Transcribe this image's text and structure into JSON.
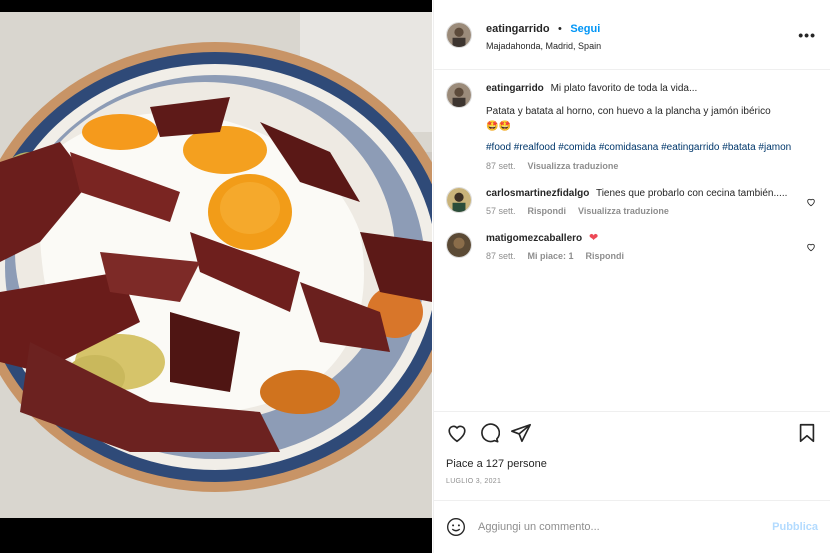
{
  "post": {
    "username": "eatingarrido",
    "follow_label": "Segui",
    "separator": "•",
    "location": "Majadahonda, Madrid, Spain",
    "more_label": "•••"
  },
  "caption": {
    "username": "eatingarrido",
    "text": "Mi plato favorito de toda la vida...",
    "line2": "Patata y batata al horno, con huevo a la plancha y jamón ibérico",
    "emojis": "🤩🤩",
    "hashtags": "#food #realfood #comida #comidasana #eatingarrido #batata #jamon",
    "time": "87 sett.",
    "translate": "Visualizza traduzione"
  },
  "comments": [
    {
      "username": "carlosmartinezfidalgo",
      "text": "Tienes que probarlo con cecina también.....",
      "time": "57 sett.",
      "reply": "Rispondi",
      "translate": "Visualizza traduzione"
    },
    {
      "username": "matigomezcaballero",
      "text": "❤",
      "time": "87 sett.",
      "likes": "Mi piace: 1",
      "reply": "Rispondi"
    }
  ],
  "footer": {
    "likes_text": "Piace a 127 persone",
    "date": "LUGLIO 3, 2021",
    "comment_placeholder": "Aggiungi un commento...",
    "publish_label": "Pubblica"
  },
  "icons": {
    "like": "heart-icon",
    "comment": "comment-icon",
    "share": "share-icon",
    "save": "bookmark-icon",
    "emoji": "emoji-icon"
  },
  "colors": {
    "accent": "#0095f6",
    "hashtag": "#00376b",
    "muted": "#8e8e8e",
    "heart": "#ed4956",
    "publish_disabled": "#b3dbff"
  }
}
